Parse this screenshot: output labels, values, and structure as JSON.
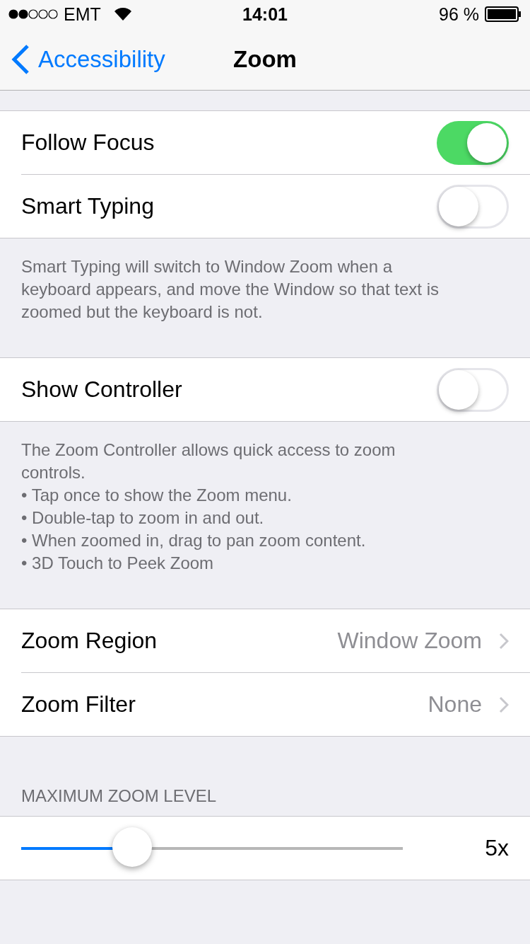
{
  "status_bar": {
    "carrier": "EMT",
    "time": "14:01",
    "battery": "96 %"
  },
  "nav": {
    "back": "Accessibility",
    "title": "Zoom"
  },
  "sections": [
    {
      "rows": [
        {
          "kind": "switch",
          "label": "Follow Focus",
          "on": true
        },
        {
          "kind": "switch",
          "label": "Smart Typing",
          "on": false
        }
      ],
      "footer": [
        "Smart Typing will switch to Window Zoom when a keyboard appears, and move the Window so that text is zoomed but the keyboard is not."
      ]
    },
    {
      "rows": [
        {
          "kind": "switch",
          "label": "Show Controller",
          "on": false
        }
      ],
      "footer": [
        "The Zoom Controller allows quick access to zoom controls.",
        "• Tap once to show the Zoom menu.",
        "• Double-tap to zoom in and out.",
        "• When zoomed in, drag to pan zoom content.",
        "• 3D Touch to Peek Zoom"
      ]
    },
    {
      "rows": [
        {
          "kind": "detail",
          "label": "Zoom Region",
          "value": "Window Zoom"
        },
        {
          "kind": "detail",
          "label": "Zoom Filter",
          "value": "None"
        }
      ]
    },
    {
      "header": "MAXIMUM ZOOM LEVEL",
      "rows": [
        {
          "kind": "slider",
          "level": 0.29,
          "value": "5x"
        }
      ]
    }
  ]
}
